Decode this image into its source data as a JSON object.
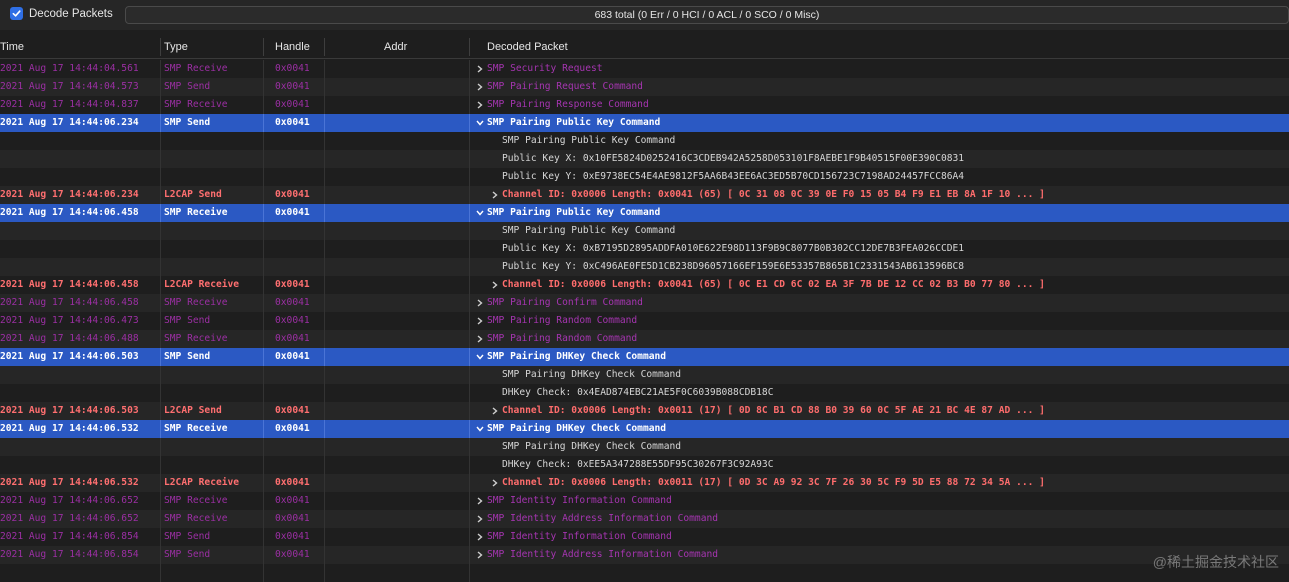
{
  "toolbar": {
    "decode_packets_label": "Decode Packets",
    "decode_packets_checked": true,
    "summary": "683 total (0 Err / 0 HCI / 0 ACL / 0 SCO / 0 Misc)"
  },
  "columns": {
    "time": "Time",
    "type": "Type",
    "handle": "Handle",
    "addr": "Addr",
    "decoded": "Decoded Packet"
  },
  "rows": [
    {
      "kind": "dim",
      "time": "2021 Aug 17 14:44:04.561",
      "type": "SMP Receive",
      "handle": "0x0041",
      "arrow": "right",
      "decoded": "SMP Security Request"
    },
    {
      "kind": "dim",
      "time": "2021 Aug 17 14:44:04.573",
      "type": "SMP Send",
      "handle": "0x0041",
      "arrow": "right",
      "decoded": "SMP Pairing Request Command"
    },
    {
      "kind": "dim",
      "time": "2021 Aug 17 14:44:04.837",
      "type": "SMP Receive",
      "handle": "0x0041",
      "arrow": "right",
      "decoded": "SMP Pairing Response Command"
    },
    {
      "kind": "sel",
      "time": "2021 Aug 17 14:44:06.234",
      "type": "SMP Send",
      "handle": "0x0041",
      "arrow": "down",
      "decoded": "SMP Pairing Public Key Command"
    },
    {
      "kind": "detail",
      "decoded": "SMP Pairing Public Key Command"
    },
    {
      "kind": "detail",
      "decoded": "Public Key X: 0x10FE5824D0252416C3CDEB942A5258D053101F8AEBE1F9B40515F00E390C0831"
    },
    {
      "kind": "detail",
      "decoded": "Public Key Y: 0xE9738EC54E4AE9812F5AA6B43EE6AC3ED5B70CD156723C7198AD24457FCC86A4"
    },
    {
      "kind": "l2",
      "time": "2021 Aug 17 14:44:06.234",
      "type": "L2CAP Send",
      "handle": "0x0041",
      "arrow": "right",
      "decoded": "Channel ID: 0x0006  Length: 0x0041 (65) [ 0C 31 08 0C 39 0E F0 15 05 B4 F9 E1 EB 8A 1F 10 ... ]"
    },
    {
      "kind": "sel",
      "time": "2021 Aug 17 14:44:06.458",
      "type": "SMP Receive",
      "handle": "0x0041",
      "arrow": "down",
      "decoded": "SMP Pairing Public Key Command"
    },
    {
      "kind": "detail",
      "decoded": "SMP Pairing Public Key Command"
    },
    {
      "kind": "detail",
      "decoded": "Public Key X: 0xB7195D2895ADDFA010E622E98D113F9B9C8077B0B302CC12DE7B3FEA026CCDE1"
    },
    {
      "kind": "detail",
      "decoded": "Public Key Y: 0xC496AE0FE5D1CB238D96057166EF159E6E53357B865B1C2331543AB613596BC8"
    },
    {
      "kind": "l2",
      "time": "2021 Aug 17 14:44:06.458",
      "type": "L2CAP Receive",
      "handle": "0x0041",
      "arrow": "right",
      "decoded": "Channel ID: 0x0006  Length: 0x0041 (65) [ 0C E1 CD 6C 02 EA 3F 7B DE 12 CC 02 B3 B0 77 80 ... ]"
    },
    {
      "kind": "dim",
      "time": "2021 Aug 17 14:44:06.458",
      "type": "SMP Receive",
      "handle": "0x0041",
      "arrow": "right",
      "decoded": "SMP Pairing Confirm Command"
    },
    {
      "kind": "dim",
      "time": "2021 Aug 17 14:44:06.473",
      "type": "SMP Send",
      "handle": "0x0041",
      "arrow": "right",
      "decoded": "SMP Pairing Random Command"
    },
    {
      "kind": "dim",
      "time": "2021 Aug 17 14:44:06.488",
      "type": "SMP Receive",
      "handle": "0x0041",
      "arrow": "right",
      "decoded": "SMP Pairing Random Command"
    },
    {
      "kind": "sel",
      "time": "2021 Aug 17 14:44:06.503",
      "type": "SMP Send",
      "handle": "0x0041",
      "arrow": "down",
      "decoded": "SMP Pairing DHKey Check Command"
    },
    {
      "kind": "detail",
      "decoded": "SMP Pairing DHKey Check Command"
    },
    {
      "kind": "detail",
      "decoded": "DHKey Check: 0x4EAD874EBC21AE5F0C6039B088CDB18C"
    },
    {
      "kind": "l2",
      "time": "2021 Aug 17 14:44:06.503",
      "type": "L2CAP Send",
      "handle": "0x0041",
      "arrow": "right",
      "decoded": "Channel ID: 0x0006  Length: 0x0011 (17) [ 0D 8C B1 CD 88 B0 39 60 0C 5F AE 21 BC 4E 87 AD ... ]"
    },
    {
      "kind": "sel",
      "time": "2021 Aug 17 14:44:06.532",
      "type": "SMP Receive",
      "handle": "0x0041",
      "arrow": "down",
      "decoded": "SMP Pairing DHKey Check Command"
    },
    {
      "kind": "detail",
      "decoded": "SMP Pairing DHKey Check Command"
    },
    {
      "kind": "detail",
      "decoded": "DHKey Check: 0xEE5A347288E55DF95C30267F3C92A93C"
    },
    {
      "kind": "l2",
      "time": "2021 Aug 17 14:44:06.532",
      "type": "L2CAP Receive",
      "handle": "0x0041",
      "arrow": "right",
      "decoded": "Channel ID: 0x0006  Length: 0x0011 (17) [ 0D 3C A9 92 3C 7F 26 30 5C F9 5D E5 88 72 34 5A ... ]"
    },
    {
      "kind": "dim",
      "time": "2021 Aug 17 14:44:06.652",
      "type": "SMP Receive",
      "handle": "0x0041",
      "arrow": "right",
      "decoded": "SMP Identity Information Command"
    },
    {
      "kind": "dim",
      "time": "2021 Aug 17 14:44:06.652",
      "type": "SMP Receive",
      "handle": "0x0041",
      "arrow": "right",
      "decoded": "SMP Identity Address Information Command"
    },
    {
      "kind": "dim",
      "time": "2021 Aug 17 14:44:06.854",
      "type": "SMP Send",
      "handle": "0x0041",
      "arrow": "right",
      "decoded": "SMP Identity Information Command"
    },
    {
      "kind": "dim",
      "time": "2021 Aug 17 14:44:06.854",
      "type": "SMP Send",
      "handle": "0x0041",
      "arrow": "right",
      "decoded": "SMP Identity Address Information Command"
    },
    {
      "kind": "blank"
    }
  ],
  "watermark": "@稀土掘金技术社区"
}
